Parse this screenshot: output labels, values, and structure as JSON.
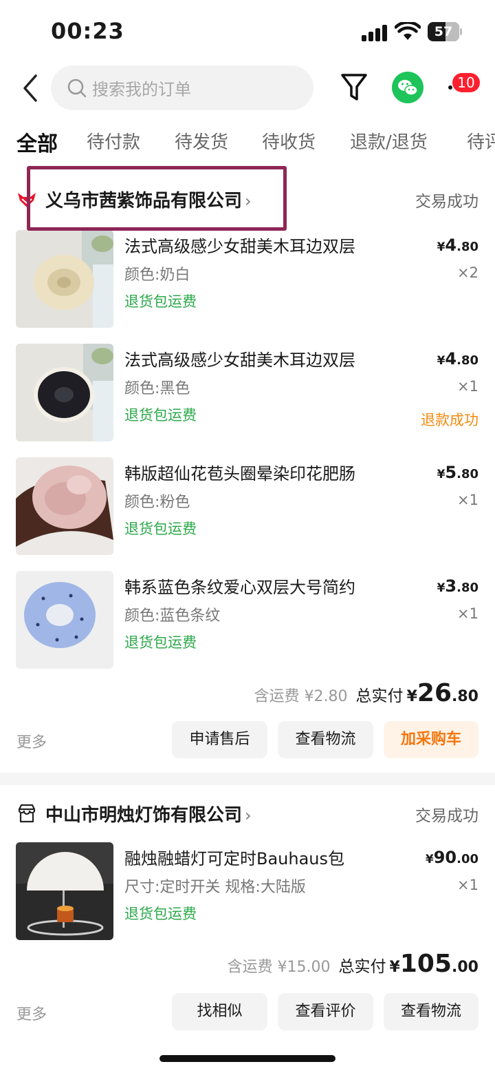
{
  "status_bar": {
    "time": "00:23",
    "battery": "57"
  },
  "search": {
    "placeholder": "搜索我的订单"
  },
  "messages": {
    "badge": "10"
  },
  "tabs": [
    "全部",
    "待付款",
    "待发货",
    "待收货",
    "退款/退货",
    "待评"
  ],
  "icons": {
    "back": "chevron-left-icon",
    "search": "search-icon",
    "filter": "filter-icon",
    "wechat": "wechat-icon",
    "messages": "more-dots-icon",
    "shop1": "tmall-cat-icon",
    "shop2": "store-icon"
  },
  "colors": {
    "accent": "#f5760d",
    "green": "#2ba84a",
    "badge": "#ff1f2e",
    "highlight": "#8e2656"
  },
  "orders": [
    {
      "shop": "义乌市茜紫饰品有限公司",
      "status": "交易成功",
      "items": [
        {
          "title": "法式高级感少女甜美木耳边双层",
          "spec": "颜色:奶白",
          "tag": "退货包运费",
          "cur": "¥",
          "price_int": "4",
          "price_dec": ".80",
          "qty": "×2"
        },
        {
          "title": "法式高级感少女甜美木耳边双层",
          "spec": "颜色:黑色",
          "tag": "退货包运费",
          "cur": "¥",
          "price_int": "4",
          "price_dec": ".80",
          "qty": "×1",
          "refund": "退款成功"
        },
        {
          "title": "韩版超仙花苞头圈晕染印花肥肠",
          "spec": "颜色:粉色",
          "tag": "退货包运费",
          "cur": "¥",
          "price_int": "5",
          "price_dec": ".80",
          "qty": "×1"
        },
        {
          "title": "韩系蓝色条纹爱心双层大号简约",
          "spec": "颜色:蓝色条纹",
          "tag": "退货包运费",
          "cur": "¥",
          "price_int": "3",
          "price_dec": ".80",
          "qty": "×1"
        }
      ],
      "shipping": "含运费 ¥2.80",
      "total_label": "总实付",
      "total_cur": "¥",
      "total_int": "26",
      "total_dec": ".80",
      "more": "更多",
      "buttons": [
        "申请售后",
        "查看物流",
        "加采购车"
      ]
    },
    {
      "shop": "中山市明烛灯饰有限公司",
      "status": "交易成功",
      "items": [
        {
          "title": "融烛融蜡灯可定时Bauhaus包",
          "spec": "尺寸:定时开关 规格:大陆版",
          "tag": "退货包运费",
          "cur": "¥",
          "price_int": "90",
          "price_dec": ".00",
          "qty": "×1"
        }
      ],
      "shipping": "含运费 ¥15.00",
      "total_label": "总实付",
      "total_cur": "¥",
      "total_int": "105",
      "total_dec": ".00",
      "more": "更多",
      "buttons": [
        "找相似",
        "查看评价",
        "查看物流"
      ]
    }
  ]
}
